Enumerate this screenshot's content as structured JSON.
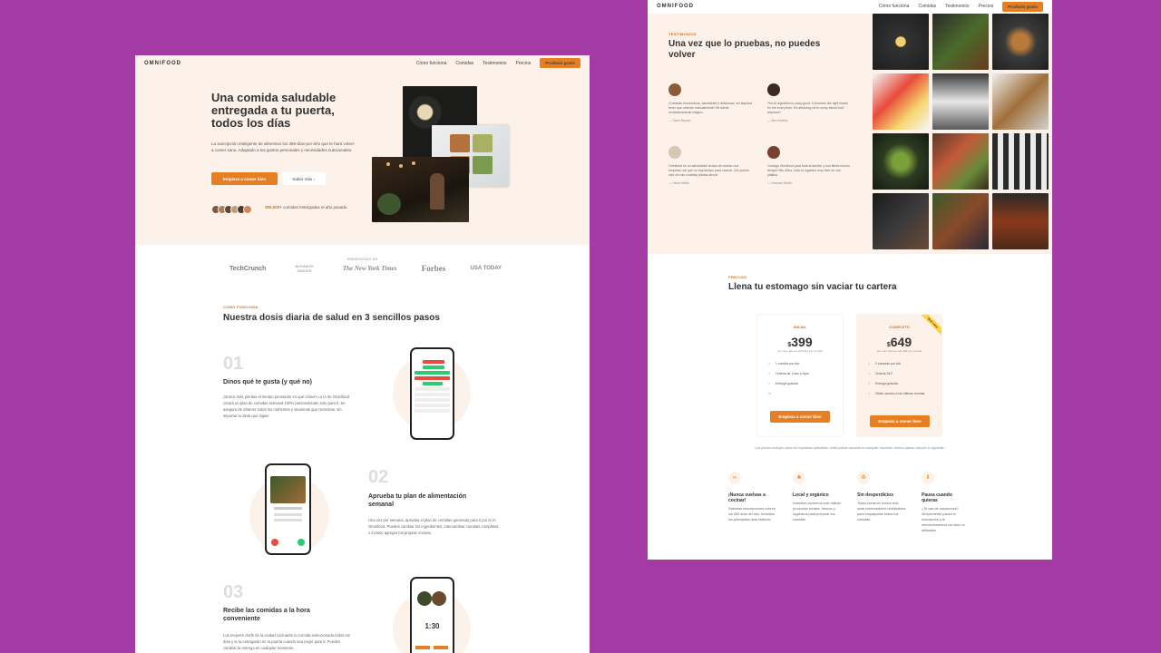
{
  "nav": {
    "logo": "OMNIFOOD",
    "links": [
      "Cómo funciona",
      "Comidas",
      "Testimonios",
      "Precios"
    ],
    "cta": "Pruébalo gratis"
  },
  "hero": {
    "title": "Una comida saludable entregada a tu puerta, todos los días",
    "text": "La suscripción inteligente de alimentos los 365-días-por-año que te hará volver a comer sano. Adaptado a tus gustos personales y necesidades nutricionales.",
    "btn_primary": "Empieza a comer bien",
    "btn_secondary": "Saber más ↓",
    "delivered_count": "250,000+",
    "delivered_text": "comidas entregadas el año pasado."
  },
  "featured": {
    "label": "PRESENTADO EN",
    "logos": [
      "TechCrunch",
      "BUSINESS INSIDER",
      "The New York Times",
      "Forbes",
      "USA TODAY"
    ]
  },
  "how": {
    "subheading": "CÓMO FUNCIONA",
    "heading": "Nuestra dosis diaria de salud en 3 sencillos pasos",
    "steps": [
      {
        "num": "01",
        "title": "Dinos qué te gusta (y qué no)",
        "text": "¡Nunca más pierdas el tiempo pensando en qué comer! La IA de Omnifood creará un plan de comidas semanal 100% personalizado solo para ti. Se asegura de obtener todos los nutrientes y vitaminas que necesitas, sin importar tu dieta que sigas!"
      },
      {
        "num": "02",
        "title": "Aprueba tu plan de alimentación semanal",
        "text": "Una vez por semana, aprueba el plan de comidas generado para ti por la IA Omnifood. Puedes cambiar los ingredientes, intercambiar comidas completas o incluso agregar tus propias recetas."
      },
      {
        "num": "03",
        "title": "Recibe las comidas a la hora conveniente",
        "text": "Los mejores chefs de la ciudad cocinarán tu comida seleccionada todos los días y te la entregarán en tu puerta cuando sea mejor para ti. Puedes cambiar la entrega en cualquier momento."
      }
    ],
    "phone_time": "1:30"
  },
  "testimonials": {
    "subheading": "TESTIMONIOS",
    "heading": "Una vez que lo pruebas, no puedes volver",
    "items": [
      {
        "text": "¡Comidas económicas, saludables y deliciosas, sin siquiera tener que ordenar manualmente! Se siente verdaderamente mágico.",
        "name": "— Dave Bryson"
      },
      {
        "text": "The AI algorithm is crazy good, it chooses the right meals for me every time. It's amazing not to worry about food anymore!",
        "name": "— Ben Hadley"
      },
      {
        "text": "Omnifood es un salvavidas! Acabo de montar una empresa, así que no hay tiempo para cocinar. ¡No podría vivir sin mis comidas diarias ahora!",
        "name": "— Steve Miller"
      },
      {
        "text": "Consigo Omnifood para toda la familia, y nos libera mucho tiempo! Mis niños, toda el orgánico muy bien en sus platitos.",
        "name": "— Hannah Smith"
      }
    ]
  },
  "pricing": {
    "subheading": "PRECIOS",
    "heading": "Llena tu estomago sin vaciar tu cartera",
    "plans": [
      {
        "name": "INICIAL",
        "currency": "$",
        "price": "399",
        "desc": "por mes. Eso es solo $13 por comida",
        "features": [
          "1 comida por día",
          "Ordena de 11am a 9pm",
          "Entrega gratuita",
          "✕"
        ],
        "cta": "Empieza a comer bien"
      },
      {
        "name": "COMPLETO",
        "currency": "$",
        "price": "649",
        "desc": "por mes. Eso es solo $11 por comida",
        "features": [
          "2 comidas por día",
          "Ordena 24/7",
          "Entrega gratuita",
          "Obtén acceso a las últimas recetas"
        ],
        "cta": "Empieza a comer bien",
        "ribbon": "Best value"
      }
    ],
    "note": "Los precios incluyen todos los impuestos aplicables. Usted puede cancelar en cualquier momento. Ambos planes incluyen lo siguiente:"
  },
  "features": [
    {
      "title": "¡Nunca vuelvas a cocinar!",
      "text": "Nuestras suscripciones cubren los 365 días del año, incluidos los principales días festivos."
    },
    {
      "title": "Local y orgánico",
      "text": "Nuestros cocineros solo utilizan productos locales, frescos y orgánicos para preparar tus comidas."
    },
    {
      "title": "Sin desperdicios",
      "text": "Todos nuestros socios solo usan contenedores reutilizables para empaquetar todas tus comidas."
    },
    {
      "title": "Pausa cuando quieras",
      "text": "¿Te vas de vacaciones? Simplemente pausa tu suscripción y te reembolsaremos los días no utilizados."
    }
  ],
  "colors": {
    "background": "#a43aa3",
    "accent": "#e67e22",
    "tint": "#fdf2e9"
  }
}
